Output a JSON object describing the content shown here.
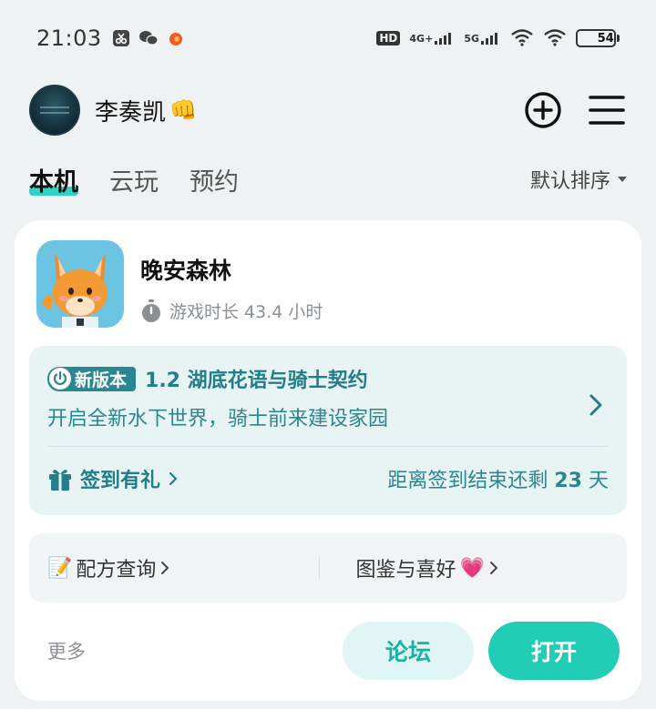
{
  "status_bar": {
    "time": "21:03",
    "network_hd": "HD",
    "network_4g": "4G+",
    "network_5g": "5G",
    "battery": "54",
    "battery_level": 0.54
  },
  "header": {
    "username": "李奏凯",
    "username_emoji": "👊"
  },
  "tabs": [
    {
      "label": "本机",
      "active": true
    },
    {
      "label": "云玩",
      "active": false
    },
    {
      "label": "预约",
      "active": false
    }
  ],
  "sort_label": "默认排序",
  "game": {
    "title": "晚安森林",
    "playtime": "游戏时长 43.4 小时"
  },
  "update": {
    "badge": "新版本",
    "title": "1.2 湖底花语与骑士契约",
    "subtitle": "开启全新水下世界，骑士前来建设家园"
  },
  "checkin": {
    "label": "签到有礼",
    "remaining_prefix": "距离签到结束还剩",
    "remaining_days": "23",
    "remaining_suffix": "天"
  },
  "links": {
    "recipe_emoji": "📝",
    "recipe": "配方查询",
    "collection": "图鉴与喜好",
    "collection_emoji": "💗"
  },
  "actions": {
    "more": "更多",
    "forum": "论坛",
    "open": "打开"
  },
  "colors": {
    "accent": "#22cdb6",
    "update_text": "#227f89",
    "badge_bg": "#2a8791"
  }
}
